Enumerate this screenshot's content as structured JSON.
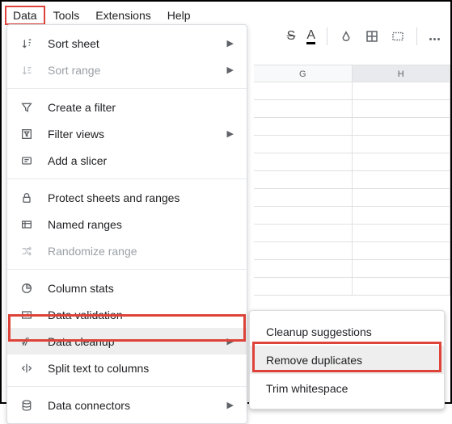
{
  "menubar": {
    "data": "Data",
    "tools": "Tools",
    "extensions": "Extensions",
    "help": "Help"
  },
  "columns": {
    "g": "G",
    "h": "H"
  },
  "menu": {
    "sort_sheet": "Sort sheet",
    "sort_range": "Sort range",
    "create_filter": "Create a filter",
    "filter_views": "Filter views",
    "add_slicer": "Add a slicer",
    "protect": "Protect sheets and ranges",
    "named_ranges": "Named ranges",
    "randomize": "Randomize range",
    "column_stats": "Column stats",
    "data_validation": "Data validation",
    "data_cleanup": "Data cleanup",
    "split_text": "Split text to columns",
    "data_connectors": "Data connectors"
  },
  "submenu": {
    "cleanup_suggestions": "Cleanup suggestions",
    "remove_duplicates": "Remove duplicates",
    "trim_whitespace": "Trim whitespace"
  }
}
